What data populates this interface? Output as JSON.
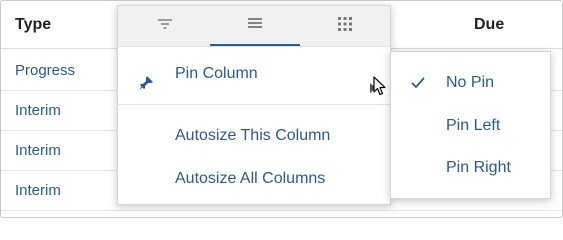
{
  "table": {
    "headers": {
      "type": "Type",
      "due": "Due"
    },
    "rows": [
      "Progress",
      "Interim",
      "Interim",
      "Interim"
    ]
  },
  "column_menu": {
    "tabs": [
      {
        "icon": "filter-icon",
        "active": false
      },
      {
        "icon": "menu-lines-icon",
        "active": true
      },
      {
        "icon": "grid-icon",
        "active": false
      }
    ],
    "items": {
      "pin_column": "Pin Column",
      "autosize_this": "Autosize This Column",
      "autosize_all": "Autosize All Columns"
    }
  },
  "pin_submenu": {
    "items": [
      "No Pin",
      "Pin Left",
      "Pin Right"
    ],
    "selected": "No Pin"
  },
  "colors": {
    "link_text": "#2e5a8a",
    "active_tab_underline": "#2f5b87"
  }
}
